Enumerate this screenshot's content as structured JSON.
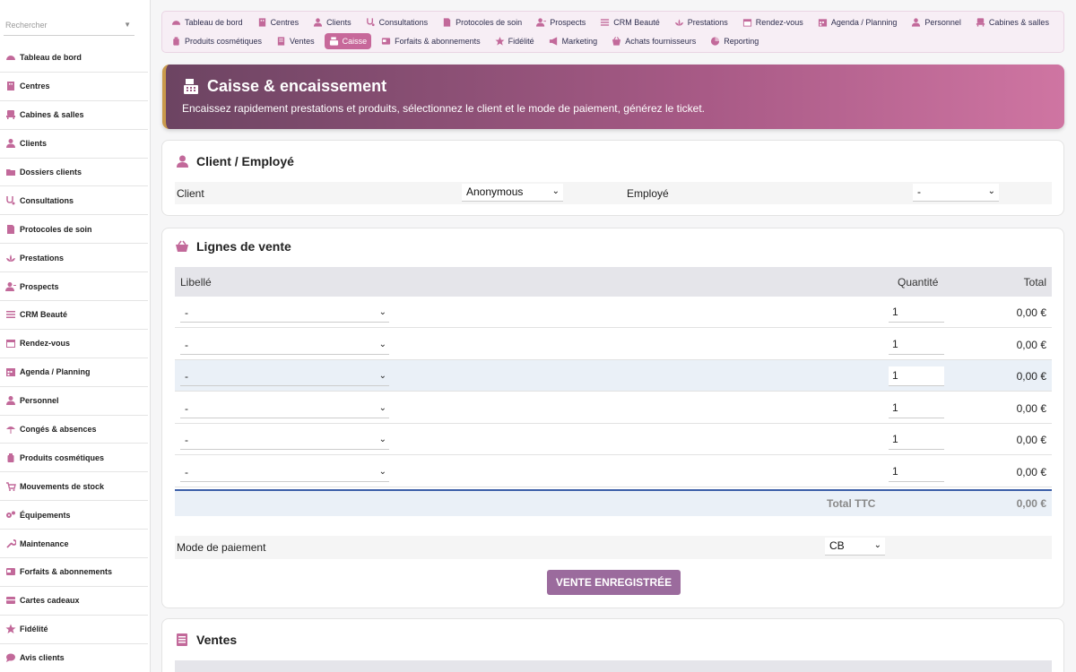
{
  "search": {
    "placeholder": "Rechercher"
  },
  "sidebar": {
    "items": [
      {
        "label": "Tableau de bord",
        "icon": "gauge-icon"
      },
      {
        "label": "Centres",
        "icon": "building-icon"
      },
      {
        "label": "Cabines & salles",
        "icon": "chair-icon"
      },
      {
        "label": "Clients",
        "icon": "user-icon"
      },
      {
        "label": "Dossiers clients",
        "icon": "folder-icon"
      },
      {
        "label": "Consultations",
        "icon": "stethoscope-icon"
      },
      {
        "label": "Protocoles de soin",
        "icon": "file-icon"
      },
      {
        "label": "Prestations",
        "icon": "spa-icon"
      },
      {
        "label": "Prospects",
        "icon": "user-plus-icon"
      },
      {
        "label": "CRM Beauté",
        "icon": "list-icon"
      },
      {
        "label": "Rendez-vous",
        "icon": "calendar-icon"
      },
      {
        "label": "Agenda / Planning",
        "icon": "calendar-grid-icon"
      },
      {
        "label": "Personnel",
        "icon": "user-tie-icon"
      },
      {
        "label": "Congés & absences",
        "icon": "umbrella-icon"
      },
      {
        "label": "Produits cosmétiques",
        "icon": "bottle-icon"
      },
      {
        "label": "Mouvements de stock",
        "icon": "cart-icon"
      },
      {
        "label": "Équipements",
        "icon": "gears-icon"
      },
      {
        "label": "Maintenance",
        "icon": "wrench-icon"
      },
      {
        "label": "Forfaits & abonnements",
        "icon": "card-icon"
      },
      {
        "label": "Cartes cadeaux",
        "icon": "gift-card-icon"
      },
      {
        "label": "Fidélité",
        "icon": "star-icon"
      },
      {
        "label": "Avis clients",
        "icon": "comment-icon"
      }
    ]
  },
  "topmenu": {
    "row1": [
      {
        "label": "Tableau de bord",
        "icon": "gauge-icon"
      },
      {
        "label": "Centres",
        "icon": "building-icon"
      },
      {
        "label": "Clients",
        "icon": "user-icon"
      },
      {
        "label": "Consultations",
        "icon": "stethoscope-icon"
      },
      {
        "label": "Protocoles de soin",
        "icon": "file-icon"
      },
      {
        "label": "Prospects",
        "icon": "user-plus-icon"
      },
      {
        "label": "CRM Beauté",
        "icon": "list-icon"
      },
      {
        "label": "Prestations",
        "icon": "spa-icon"
      },
      {
        "label": "Rendez-vous",
        "icon": "calendar-icon"
      },
      {
        "label": "Agenda / Planning",
        "icon": "calendar-grid-icon"
      },
      {
        "label": "Personnel",
        "icon": "user-tie-icon"
      },
      {
        "label": "Cabines & salles",
        "icon": "chair-icon"
      }
    ],
    "row2": [
      {
        "label": "Produits cosmétiques",
        "icon": "bottle-icon"
      },
      {
        "label": "Ventes",
        "icon": "receipt-icon"
      },
      {
        "label": "Caisse",
        "icon": "cash-register-icon",
        "active": true
      },
      {
        "label": "Forfaits & abonnements",
        "icon": "card-icon"
      },
      {
        "label": "Fidélité",
        "icon": "star-icon"
      },
      {
        "label": "Marketing",
        "icon": "megaphone-icon"
      },
      {
        "label": "Achats fournisseurs",
        "icon": "basket-icon"
      },
      {
        "label": "Reporting",
        "icon": "pie-icon"
      }
    ]
  },
  "banner": {
    "title": "Caisse & encaissement",
    "subtitle": "Encaissez rapidement prestations et produits, sélectionnez le client et le mode de paiement, générez le ticket."
  },
  "client_section": {
    "title": "Client / Employé",
    "client_label": "Client",
    "client_value": "Anonymous",
    "employee_label": "Employé",
    "employee_value": "-"
  },
  "sale_lines": {
    "title": "Lignes de vente",
    "headers": {
      "label": "Libellé",
      "qty": "Quantité",
      "total": "Total"
    },
    "rows": [
      {
        "product": "-",
        "qty": "1",
        "total": "0,00 €"
      },
      {
        "product": "-",
        "qty": "1",
        "total": "0,00 €"
      },
      {
        "product": "-",
        "qty": "1",
        "total": "0,00 €"
      },
      {
        "product": "-",
        "qty": "1",
        "total": "0,00 €"
      },
      {
        "product": "-",
        "qty": "1",
        "total": "0,00 €"
      },
      {
        "product": "-",
        "qty": "1",
        "total": "0,00 €"
      }
    ],
    "total_label": "Total TTC",
    "total_value": "0,00 €",
    "payment_label": "Mode de paiement",
    "payment_value": "CB",
    "submit_label": "VENTE ENREGISTRÉE"
  },
  "sales": {
    "title": "Ventes"
  },
  "colors": {
    "accent": "#c7689a",
    "button": "#9b6b9d",
    "icon": "#c2699a"
  }
}
